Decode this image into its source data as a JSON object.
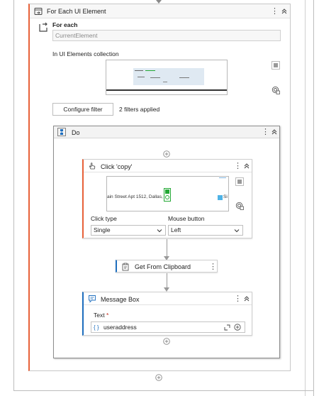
{
  "foreach": {
    "title": "For Each UI Element",
    "for_each_label": "For each",
    "current_element_value": "CurrentElement",
    "collection_label": "In UI Elements collection",
    "configure_filter_label": "Configure filter",
    "filters_status": "2 filters applied"
  },
  "do": {
    "title": "Do"
  },
  "click_activity": {
    "title": "Click 'copy'",
    "preview_text": "ain Street Apt 1512, Dallas,",
    "preview_side_text": "Si",
    "click_type_label": "Click type",
    "click_type_value": "Single",
    "mouse_button_label": "Mouse button",
    "mouse_button_value": "Left"
  },
  "clipboard_activity": {
    "title": "Get From Clipboard"
  },
  "message_activity": {
    "title": "Message Box",
    "text_label": "Text",
    "required_mark": "*",
    "text_value": "useraddress",
    "var_badge": "{ }"
  },
  "colors": {
    "accent_orange": "#e8623a",
    "accent_blue": "#1f6fbf",
    "highlight_green": "#22a834"
  }
}
